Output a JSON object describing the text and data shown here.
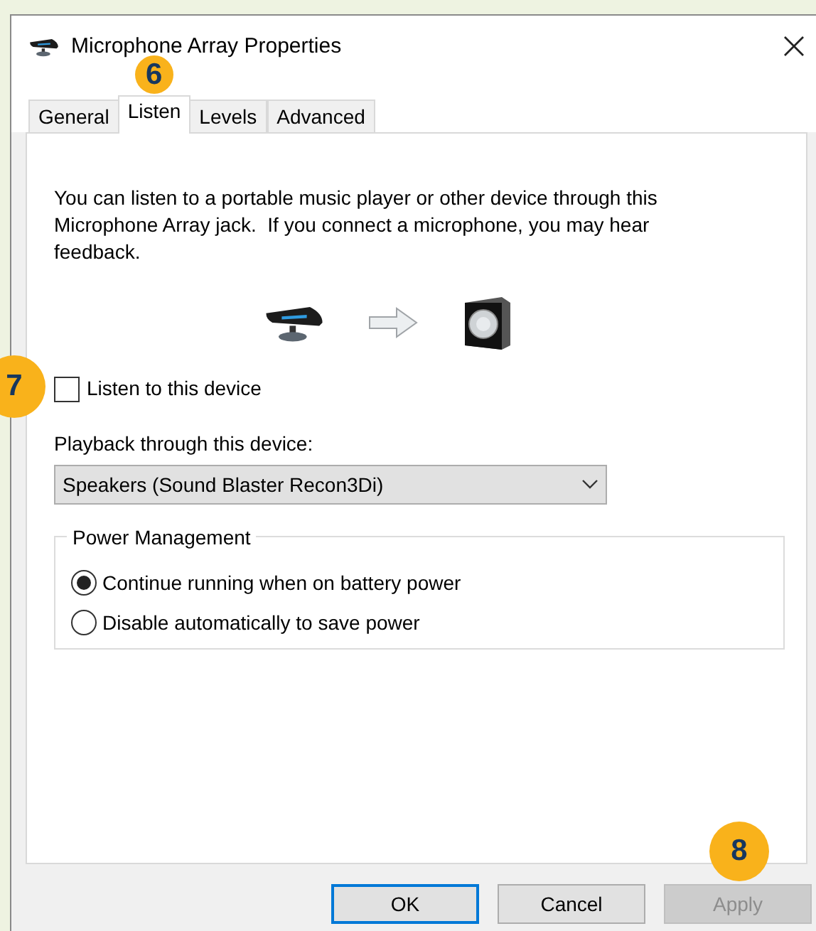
{
  "window": {
    "title": "Microphone Array Properties"
  },
  "tabs": [
    {
      "label": "General",
      "selected": false
    },
    {
      "label": "Listen",
      "selected": true,
      "callout": "6"
    },
    {
      "label": "Levels",
      "selected": false
    },
    {
      "label": "Advanced",
      "selected": false
    }
  ],
  "description": "You can listen to a portable music player or other device through this Microphone Array jack.  If you connect a microphone, you may hear feedback.",
  "listen_checkbox": {
    "label": "Listen to this device",
    "checked": false,
    "callout": "7"
  },
  "playback": {
    "label": "Playback through this device:",
    "value": "Speakers (Sound Blaster Recon3Di)"
  },
  "power_management": {
    "title": "Power Management",
    "options": [
      {
        "label": "Continue running when on battery power",
        "selected": true
      },
      {
        "label": "Disable automatically to save power",
        "selected": false
      }
    ]
  },
  "buttons": [
    {
      "label": "OK",
      "default": true,
      "disabled": false
    },
    {
      "label": "Cancel",
      "default": false,
      "disabled": false
    },
    {
      "label": "Apply",
      "default": false,
      "disabled": true,
      "callout": "8"
    }
  ]
}
